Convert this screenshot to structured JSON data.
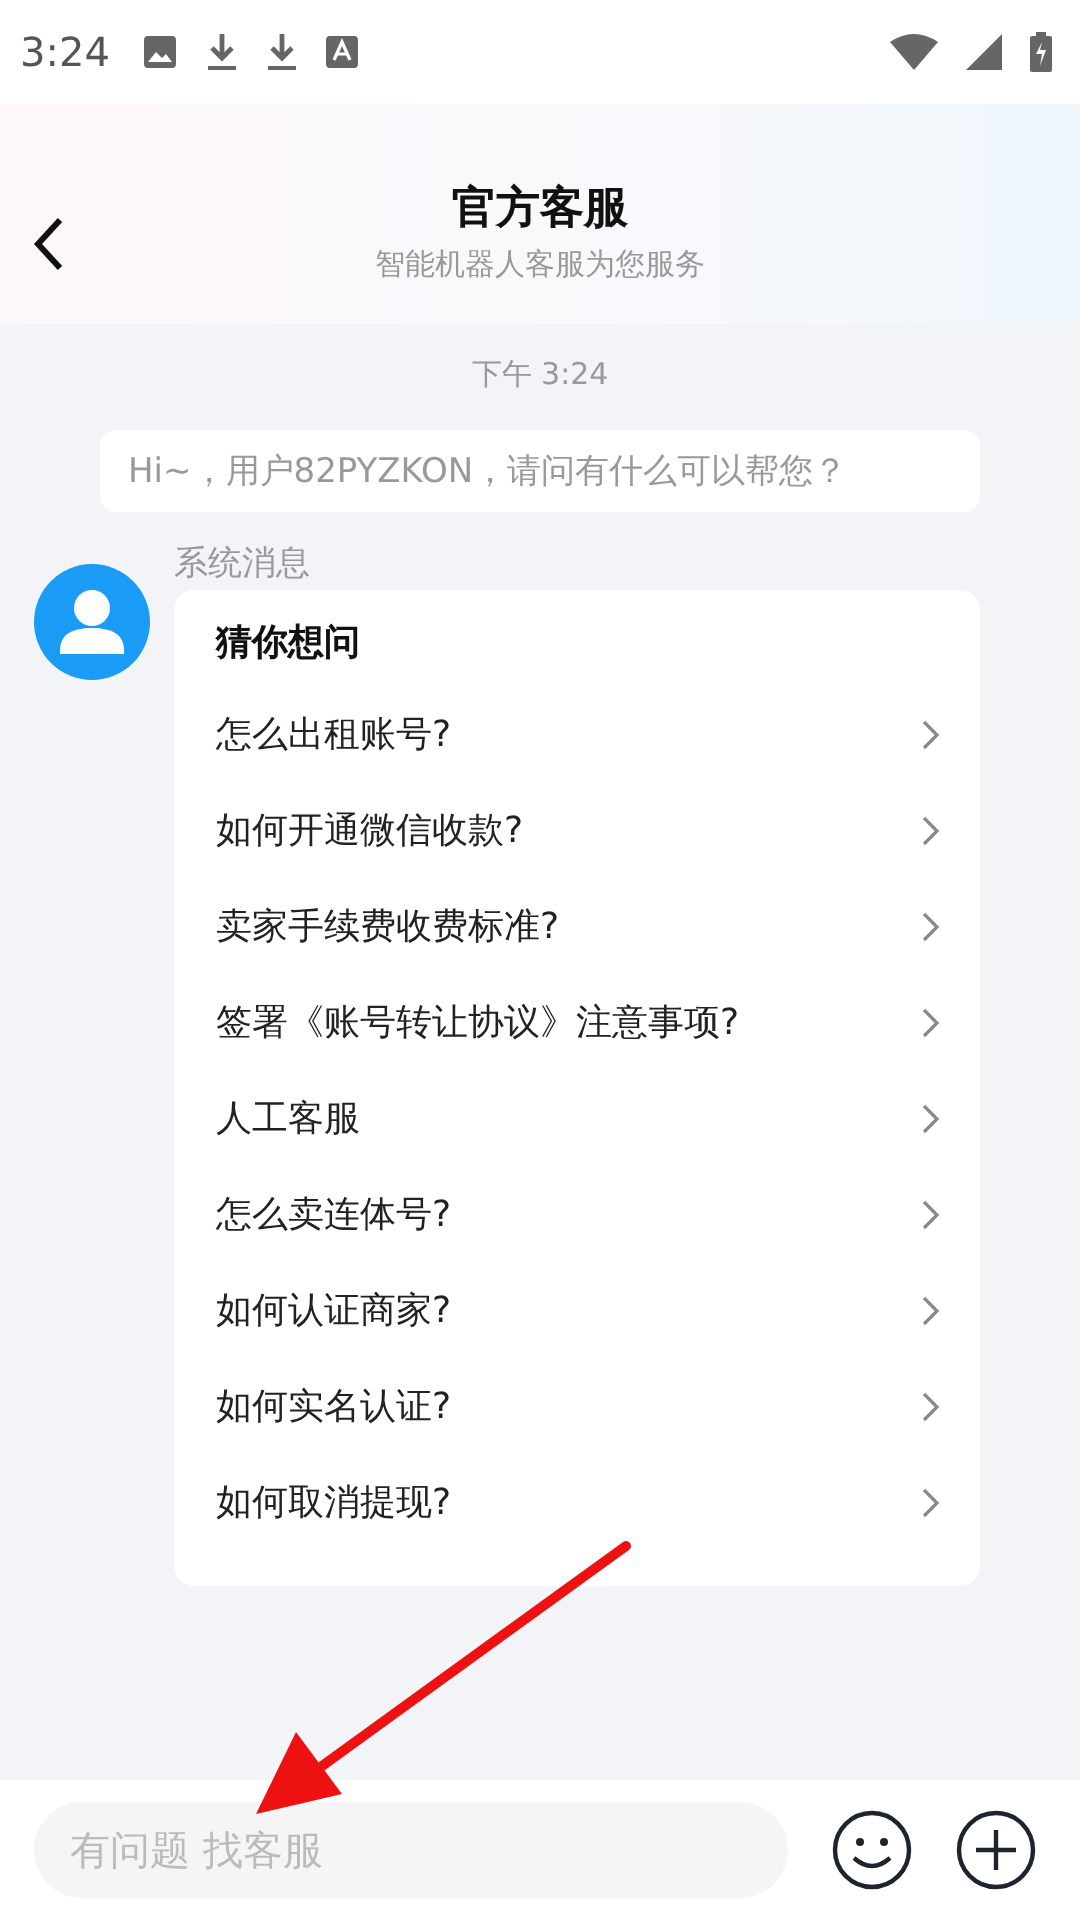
{
  "status_bar": {
    "time": "3:24"
  },
  "header": {
    "title": "官方客服",
    "subtitle": "智能机器人客服为您服务"
  },
  "chat": {
    "timestamp": "下午 3:24",
    "greeting": "Hi~，用户82PYZKON，请问有什么可以帮您？",
    "sender": "系统消息",
    "card": {
      "title": "猜你想问",
      "questions": [
        {
          "text": "怎么出租账号?"
        },
        {
          "text": "如何开通微信收款?"
        },
        {
          "text": "卖家手续费收费标准?"
        },
        {
          "text": "签署《账号转让协议》注意事项?"
        },
        {
          "text": "人工客服"
        },
        {
          "text": "怎么卖连体号?"
        },
        {
          "text": "如何认证商家?"
        },
        {
          "text": "如何实名认证?"
        },
        {
          "text": "如何取消提现?"
        }
      ]
    }
  },
  "input": {
    "placeholder": "有问题 找客服"
  }
}
